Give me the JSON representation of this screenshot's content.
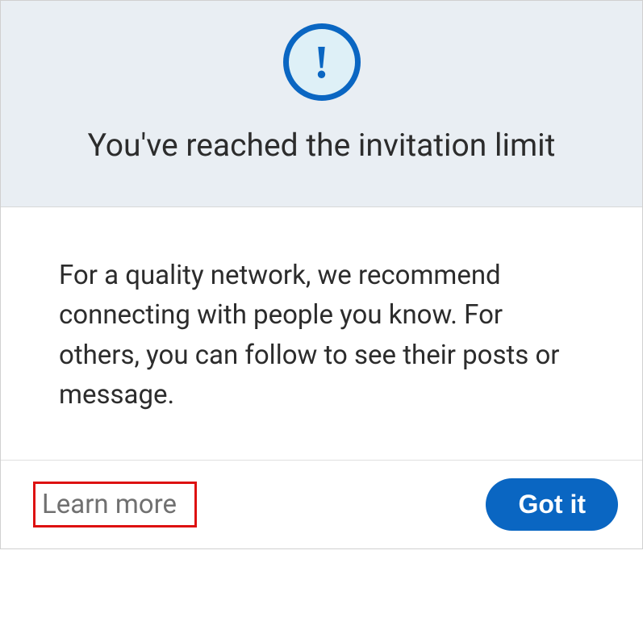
{
  "dialog": {
    "icon": "exclamation-icon",
    "exclamation_char": "!",
    "title": "You've reached the invitation limit",
    "body_text": "For a quality network, we recommend connecting with people you know. For others, you can follow to see their posts or message.",
    "learn_more_label": "Learn more",
    "got_it_label": "Got it"
  }
}
